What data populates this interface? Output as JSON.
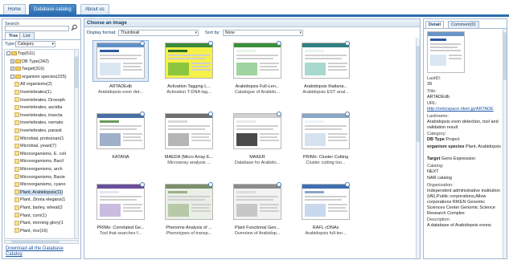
{
  "nav": {
    "tabs": [
      {
        "label": "Home",
        "active": false
      },
      {
        "label": "Database catalog",
        "active": true
      },
      {
        "label": "About us",
        "active": false
      }
    ]
  },
  "sidebar": {
    "search_label": "Search:",
    "search_value": "",
    "tabs": [
      {
        "label": "Tree",
        "active": true
      },
      {
        "label": "List",
        "active": false
      }
    ],
    "type_label": "Type:",
    "type_value": "Category",
    "tree": [
      {
        "label": "Top(611)",
        "level": 0,
        "kind": "folder",
        "toggle": "-"
      },
      {
        "label": "DB Type(342)",
        "level": 1,
        "kind": "folder",
        "toggle": "+"
      },
      {
        "label": "Target(316)",
        "level": 1,
        "kind": "folder",
        "toggle": "+"
      },
      {
        "label": "organism species(225)",
        "level": 1,
        "kind": "folder",
        "toggle": "-"
      },
      {
        "label": "All organisms(2)",
        "level": 2,
        "kind": "leaf"
      },
      {
        "label": "Invertebrates(1)",
        "level": 2,
        "kind": "leaf"
      },
      {
        "label": "Invertebrates, Drosoph",
        "level": 2,
        "kind": "leaf"
      },
      {
        "label": "Invertebrates, ascidia",
        "level": 2,
        "kind": "leaf"
      },
      {
        "label": "Invertebrates, insecta",
        "level": 2,
        "kind": "leaf"
      },
      {
        "label": "Invertebrates, nemato",
        "level": 2,
        "kind": "leaf"
      },
      {
        "label": "Invertebrates, parasit",
        "level": 2,
        "kind": "leaf"
      },
      {
        "label": "Microbial, protozoan(1",
        "level": 2,
        "kind": "leaf"
      },
      {
        "label": "Microbial, yeast(7)",
        "level": 2,
        "kind": "leaf"
      },
      {
        "label": "Microorganisms, E. coli",
        "level": 2,
        "kind": "leaf"
      },
      {
        "label": "Microorganisms, Bacil",
        "level": 2,
        "kind": "leaf"
      },
      {
        "label": "Microorganisms, arch",
        "level": 2,
        "kind": "leaf"
      },
      {
        "label": "Microorganisms, Bacte",
        "level": 2,
        "kind": "leaf"
      },
      {
        "label": "Microorganisms, cyano",
        "level": 2,
        "kind": "leaf"
      },
      {
        "label": "Plant, Arabidopsis(11)",
        "level": 2,
        "kind": "leaf",
        "selected": true
      },
      {
        "label": "Plant, Zinnia elegans(1",
        "level": 2,
        "kind": "leaf"
      },
      {
        "label": "Plant, barley, wheat(2",
        "level": 2,
        "kind": "leaf"
      },
      {
        "label": "Plant, corn(1)",
        "level": 2,
        "kind": "leaf"
      },
      {
        "label": "Plant, morning glory(1",
        "level": 2,
        "kind": "leaf"
      },
      {
        "label": "Plant, rice(16)",
        "level": 2,
        "kind": "leaf"
      }
    ],
    "download_link": "Download all the Database Catalog"
  },
  "main": {
    "header": "Choose an image",
    "display_format_label": "Display format:",
    "display_format_value": "Thumbnail",
    "sort_label": "Sort by:",
    "sort_value": "None",
    "cards": [
      {
        "title": "ARTADEdb",
        "subtitle": "Arabidopsis exon det...",
        "selected": true,
        "theme": "blue"
      },
      {
        "title": "Activation Tagging L...",
        "subtitle": "Activation T-DNA tag...",
        "theme": "greenyellow"
      },
      {
        "title": "Arabidopsis Full-Len...",
        "subtitle": "Catalogue of Arabido...",
        "theme": "green"
      },
      {
        "title": "Arabidopsis thaliana...",
        "subtitle": "Arabidopsis EST anal...",
        "theme": "teal"
      },
      {
        "title": "KATANA",
        "subtitle": "",
        "theme": "mixed"
      },
      {
        "title": "MAEDA (Micro Array E...",
        "subtitle": "Microarray analysis ...",
        "theme": "gray"
      },
      {
        "title": "MAKER",
        "subtitle": "Database for Arabido...",
        "theme": "plain"
      },
      {
        "title": "PRIMe: Cluster Cutting",
        "subtitle": "Cluster cutting too...",
        "theme": "light"
      },
      {
        "title": "PRIMe: Correlated Ge...",
        "subtitle": "Tool that searches f...",
        "theme": "purple"
      },
      {
        "title": "Phenome Analysis of ...",
        "subtitle": "Phenotypes of transp...",
        "theme": "photo"
      },
      {
        "title": "Plant Functional Gen...",
        "subtitle": "Overview of Arabidop...",
        "theme": "grayphoto"
      },
      {
        "title": "RAFL cDNAs",
        "subtitle": "Arabidopsis full-len...",
        "theme": "blue2"
      }
    ]
  },
  "detail": {
    "tabs": [
      {
        "label": "Detail",
        "active": true
      },
      {
        "label": "Comment(0)",
        "active": false
      }
    ],
    "fields": [
      {
        "text": "LastID:",
        "style": "key"
      },
      {
        "text": "39",
        "style": "val"
      },
      {
        "text": "Title:",
        "style": "key"
      },
      {
        "text": "ARTADEdb",
        "style": "val"
      },
      {
        "text": "URL:",
        "style": "key"
      },
      {
        "text": "http://omicspace.riken.jp/ARTADE",
        "style": "link"
      },
      {
        "text": "Lastiname:",
        "style": "key"
      },
      {
        "text": "Arabidopsis exon detection, tool and validation result",
        "style": "val"
      },
      {
        "text": "Category:",
        "style": "key"
      },
      {
        "text": "DB Type Project",
        "style": "cat",
        "bold": "DB Type"
      },
      {
        "text": "organism species Plant, Arabidopsis",
        "style": "cat",
        "bold": "organism species"
      },
      {
        "text": "Target Gene Expression",
        "style": "cat",
        "bold": "Target"
      },
      {
        "text": "Catalog:",
        "style": "key"
      },
      {
        "text": "NEXT",
        "style": "val"
      },
      {
        "text": "NAR catalog",
        "style": "val"
      },
      {
        "text": "Organization:",
        "style": "key"
      },
      {
        "text": "Independent administrative institution (IAI),Public corporations,Allow corporations RIKEN Genomic Sciences Center Genomic Science Research Complex",
        "style": "val"
      },
      {
        "text": "Description:",
        "style": "key"
      },
      {
        "text": "A database of Arabidopsis exons",
        "style": "val"
      }
    ]
  },
  "colors": {
    "accent": "#2a6db0",
    "link": "#1a55a5",
    "border": "#9fb8d3"
  }
}
